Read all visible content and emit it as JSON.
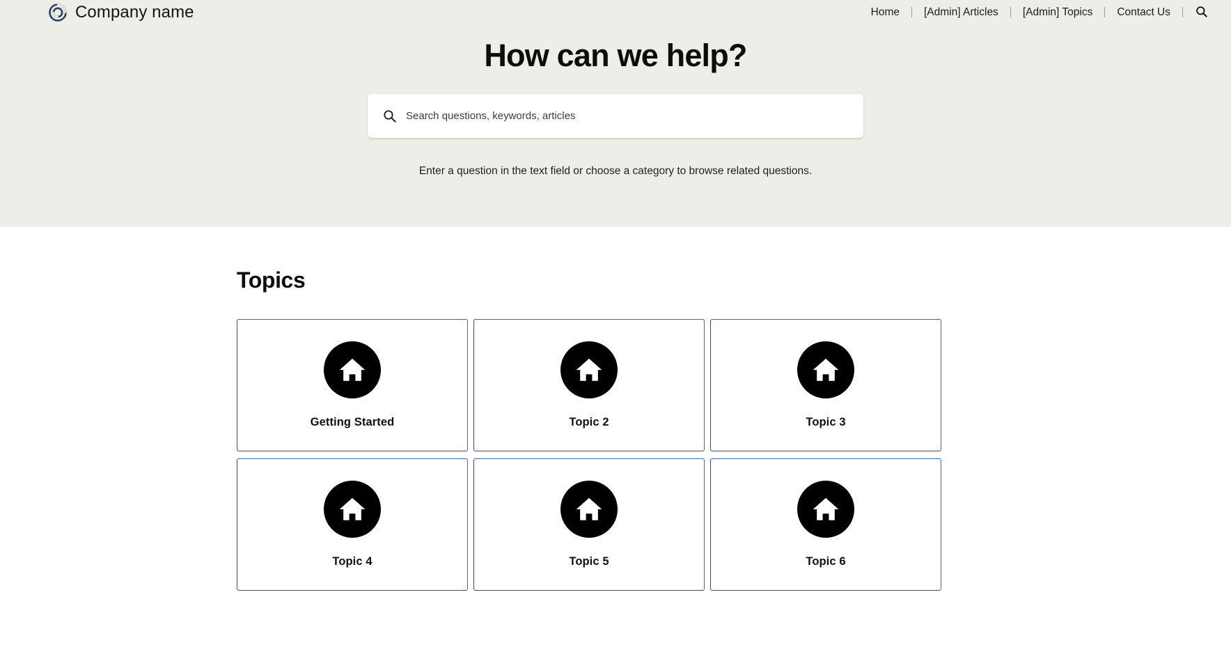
{
  "header": {
    "brand": {
      "logo_icon": "spiral-circle-logo",
      "name": "Company name",
      "logo_color": "#2b3f63"
    },
    "nav": {
      "items": [
        {
          "label": "Home",
          "name": "home"
        },
        {
          "label": "[Admin] Articles",
          "name": "admin-articles"
        },
        {
          "label": "[Admin] Topics",
          "name": "admin-topics"
        },
        {
          "label": "Contact Us",
          "name": "contact-us"
        }
      ],
      "search_icon": "search-icon"
    }
  },
  "hero": {
    "title": "How can we help?",
    "search": {
      "icon": "search-icon",
      "placeholder": "Search questions, keywords, articles",
      "value": ""
    },
    "subtitle": "Enter a question in the text field or choose a category to browse related questions.",
    "background_color": "#eeeee8"
  },
  "topics": {
    "heading": "Topics",
    "card_border_color": "#3a6cb5",
    "icon_background_color": "#000000",
    "cards": [
      {
        "label": "Getting Started",
        "icon": "home-icon"
      },
      {
        "label": "Topic 2",
        "icon": "home-icon"
      },
      {
        "label": "Topic 3",
        "icon": "home-icon"
      },
      {
        "label": "Topic 4",
        "icon": "home-icon"
      },
      {
        "label": "Topic 5",
        "icon": "home-icon"
      },
      {
        "label": "Topic 6",
        "icon": "home-icon"
      }
    ]
  }
}
